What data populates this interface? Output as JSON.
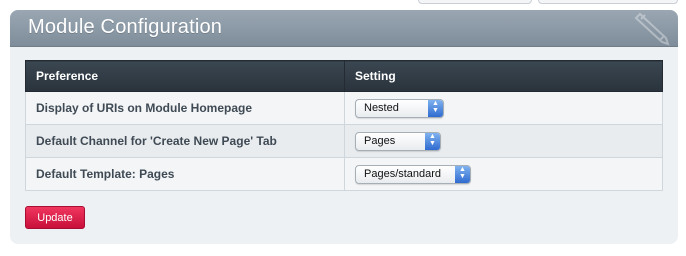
{
  "panel": {
    "title": "Module Configuration"
  },
  "table": {
    "headers": {
      "preference": "Preference",
      "setting": "Setting"
    },
    "rows": [
      {
        "preference": "Display of URIs on Module Homepage",
        "setting": "Nested"
      },
      {
        "preference": "Default Channel for 'Create New Page' Tab",
        "setting": "Pages"
      },
      {
        "preference": "Default Template: Pages",
        "setting": "Pages/standard"
      }
    ]
  },
  "actions": {
    "update_label": "Update"
  },
  "colors": {
    "header_bar": "#8896a3",
    "table_header": "#2f3942",
    "primary_button": "#e1224d",
    "select_arrow": "#3d7bd9"
  },
  "icons": {
    "header": "pencil-icon",
    "select": "chevron-up-down-icon"
  }
}
